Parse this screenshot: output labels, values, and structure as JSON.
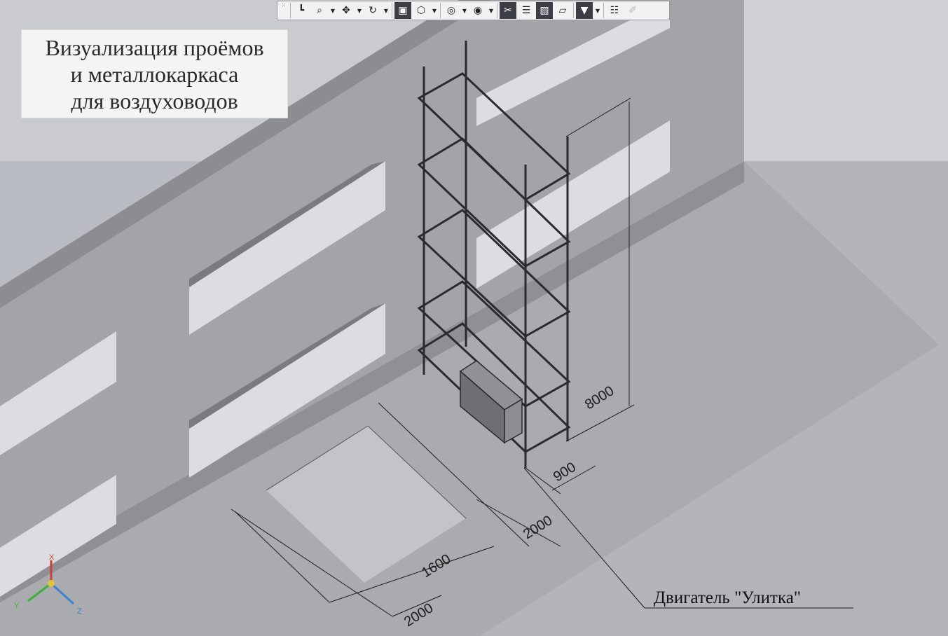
{
  "title_lines": [
    "Визуализация проёмов",
    "и металлокаркаса",
    "для воздуховодов"
  ],
  "callout": "Двигатель \"Улитка\"",
  "dimensions": {
    "height": "8000",
    "frame_depth": "900",
    "frame_length": "2000",
    "opening_width": "1600",
    "opening_length": "2000"
  },
  "axes": {
    "x": "X",
    "y": "Y",
    "z": "Z"
  },
  "toolbar": {
    "buttons": [
      {
        "name": "toolbar-grip-icon",
        "icon": "grip"
      },
      {
        "name": "orientation-icon",
        "icon": "orientation"
      },
      {
        "name": "zoom-window-icon",
        "icon": "zoom"
      },
      {
        "name": "pan-icon",
        "icon": "pan"
      },
      {
        "name": "rotate-icon",
        "icon": "rotate"
      },
      {
        "name": "shaded-view-icon",
        "icon": "cube-solid",
        "active": true
      },
      {
        "name": "wireframe-view-icon",
        "icon": "cube-wire"
      },
      {
        "name": "hide-icon",
        "icon": "eye"
      },
      {
        "name": "show-icon",
        "icon": "eye-solid"
      },
      {
        "name": "section-icon",
        "icon": "section",
        "active": true
      },
      {
        "name": "layers-icon",
        "icon": "layers"
      },
      {
        "name": "display-mode-icon",
        "icon": "display",
        "active": true
      },
      {
        "name": "perspective-icon",
        "icon": "perspective"
      },
      {
        "name": "filter-icon",
        "icon": "filter",
        "active": true
      },
      {
        "name": "properties-icon",
        "icon": "properties"
      },
      {
        "name": "pipette-icon",
        "icon": "pipette",
        "disabled": true
      }
    ]
  },
  "colors": {
    "wall_face": "#a1a3a6",
    "wall_top": "#8a8b8e",
    "wall_end": "#7e7f82",
    "floor": "#a8aaad",
    "opening_glow": "#dedfe2",
    "background": "#b9bcc2"
  }
}
